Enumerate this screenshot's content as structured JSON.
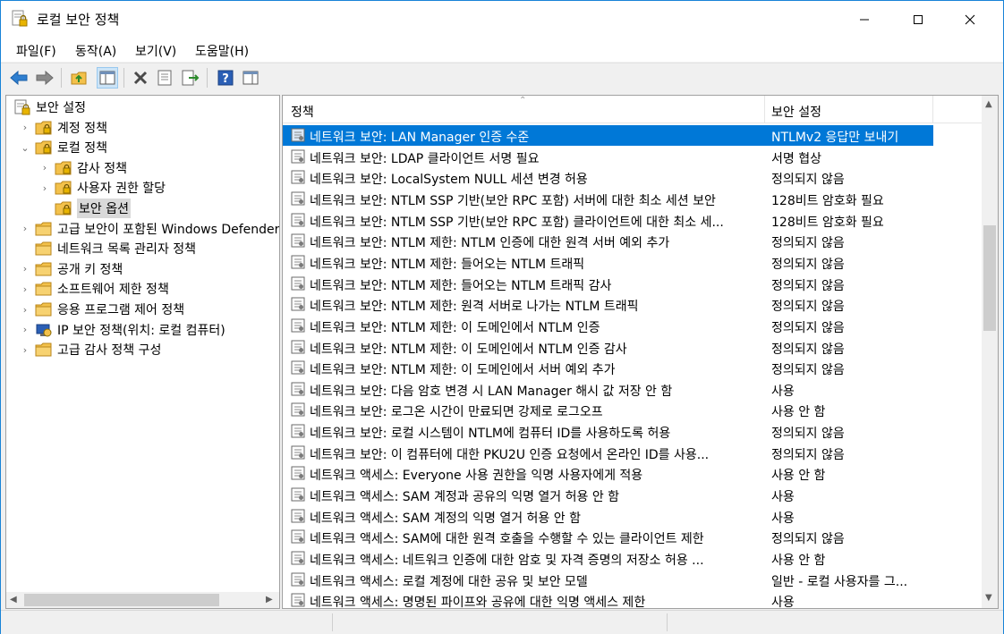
{
  "window": {
    "title": "로컬 보안 정책"
  },
  "menu": [
    "파일(F)",
    "동작(A)",
    "보기(V)",
    "도움말(H)"
  ],
  "toolbar": {
    "buttons": [
      "back-icon",
      "forward-icon",
      "up-folder-icon",
      "show-hide-tree-icon",
      "delete-icon",
      "properties-icon",
      "export-list-icon",
      "help-icon",
      "show-hide-action-pane-icon"
    ]
  },
  "tree": [
    {
      "label": "보안 설정",
      "level": 0,
      "expander": "none",
      "icon": "security-settings-icon"
    },
    {
      "label": "계정 정책",
      "level": 1,
      "expander": "collapsed",
      "icon": "policy-folder-icon"
    },
    {
      "label": "로컬 정책",
      "level": 1,
      "expander": "expanded",
      "icon": "policy-folder-icon"
    },
    {
      "label": "감사 정책",
      "level": 2,
      "expander": "collapsed",
      "icon": "policy-folder-icon"
    },
    {
      "label": "사용자 권한 할당",
      "level": 2,
      "expander": "collapsed",
      "icon": "policy-folder-icon"
    },
    {
      "label": "보안 옵션",
      "level": 2,
      "expander": "none",
      "icon": "policy-folder-icon",
      "selected": true
    },
    {
      "label": "고급 보안이 포함된 Windows Defender 방화벽",
      "level": 1,
      "expander": "collapsed",
      "icon": "folder-icon"
    },
    {
      "label": "네트워크 목록 관리자 정책",
      "level": 1,
      "expander": "none",
      "icon": "folder-icon"
    },
    {
      "label": "공개 키 정책",
      "level": 1,
      "expander": "collapsed",
      "icon": "folder-icon"
    },
    {
      "label": "소프트웨어 제한 정책",
      "level": 1,
      "expander": "collapsed",
      "icon": "folder-icon"
    },
    {
      "label": "응용 프로그램 제어 정책",
      "level": 1,
      "expander": "collapsed",
      "icon": "folder-icon"
    },
    {
      "label": "IP 보안 정책(위치: 로컬 컴퓨터)",
      "level": 1,
      "expander": "collapsed",
      "icon": "ip-security-icon"
    },
    {
      "label": "고급 감사 정책 구성",
      "level": 1,
      "expander": "collapsed",
      "icon": "folder-icon"
    }
  ],
  "columns": {
    "policy": "정책",
    "setting": "보안 설정"
  },
  "rows": [
    {
      "policy": "네트워크 보안: LAN Manager 인증 수준",
      "setting": "NTLMv2 응답만 보내기",
      "selected": true
    },
    {
      "policy": "네트워크 보안: LDAP 클라이언트 서명 필요",
      "setting": "서명 협상"
    },
    {
      "policy": "네트워크 보안: LocalSystem NULL 세션 변경 허용",
      "setting": "정의되지 않음"
    },
    {
      "policy": "네트워크 보안: NTLM SSP 기반(보안 RPC 포함) 서버에 대한 최소 세션 보안",
      "setting": "128비트 암호화 필요"
    },
    {
      "policy": "네트워크 보안: NTLM SSP 기반(보안 RPC 포함) 클라이언트에 대한 최소 세...",
      "setting": "128비트 암호화 필요"
    },
    {
      "policy": "네트워크 보안: NTLM 제한: NTLM 인증에 대한 원격 서버 예외 추가",
      "setting": "정의되지 않음"
    },
    {
      "policy": "네트워크 보안: NTLM 제한: 들어오는 NTLM 트래픽",
      "setting": "정의되지 않음"
    },
    {
      "policy": "네트워크 보안: NTLM 제한: 들어오는 NTLM 트래픽 감사",
      "setting": "정의되지 않음"
    },
    {
      "policy": "네트워크 보안: NTLM 제한: 원격 서버로 나가는 NTLM 트래픽",
      "setting": "정의되지 않음"
    },
    {
      "policy": "네트워크 보안: NTLM 제한: 이 도메인에서 NTLM 인증",
      "setting": "정의되지 않음"
    },
    {
      "policy": "네트워크 보안: NTLM 제한: 이 도메인에서 NTLM 인증 감사",
      "setting": "정의되지 않음"
    },
    {
      "policy": "네트워크 보안: NTLM 제한: 이 도메인에서 서버 예외 추가",
      "setting": "정의되지 않음"
    },
    {
      "policy": "네트워크 보안: 다음 암호 변경 시 LAN Manager 해시 값 저장 안 함",
      "setting": "사용"
    },
    {
      "policy": "네트워크 보안: 로그온 시간이 만료되면 강제로 로그오프",
      "setting": "사용 안 함"
    },
    {
      "policy": "네트워크 보안: 로컬 시스템이 NTLM에 컴퓨터 ID를 사용하도록 허용",
      "setting": "정의되지 않음"
    },
    {
      "policy": "네트워크 보안: 이 컴퓨터에 대한 PKU2U 인증 요청에서 온라인 ID를 사용...",
      "setting": "정의되지 않음"
    },
    {
      "policy": "네트워크 액세스: Everyone 사용 권한을 익명 사용자에게 적용",
      "setting": "사용 안 함"
    },
    {
      "policy": "네트워크 액세스: SAM 계정과 공유의 익명 열거 허용 안 함",
      "setting": "사용"
    },
    {
      "policy": "네트워크 액세스: SAM 계정의 익명 열거 허용 안 함",
      "setting": "사용"
    },
    {
      "policy": "네트워크 액세스: SAM에 대한 원격 호출을 수행할 수 있는 클라이언트 제한",
      "setting": "정의되지 않음"
    },
    {
      "policy": "네트워크 액세스: 네트워크 인증에 대한 암호 및 자격 증명의 저장소 허용 ...",
      "setting": "사용 안 함"
    },
    {
      "policy": "네트워크 액세스: 로컬 계정에 대한 공유 및 보안 모델",
      "setting": "일반 - 로컬 사용자를 그..."
    },
    {
      "policy": "네트워크 액세스: 명명된 파이프와 공유에 대한 익명 액세스 제한",
      "setting": "사용"
    }
  ],
  "colors": {
    "selection": "#0078d7",
    "tree_selection": "#d9d9d9",
    "window_border": "#1883d7"
  }
}
